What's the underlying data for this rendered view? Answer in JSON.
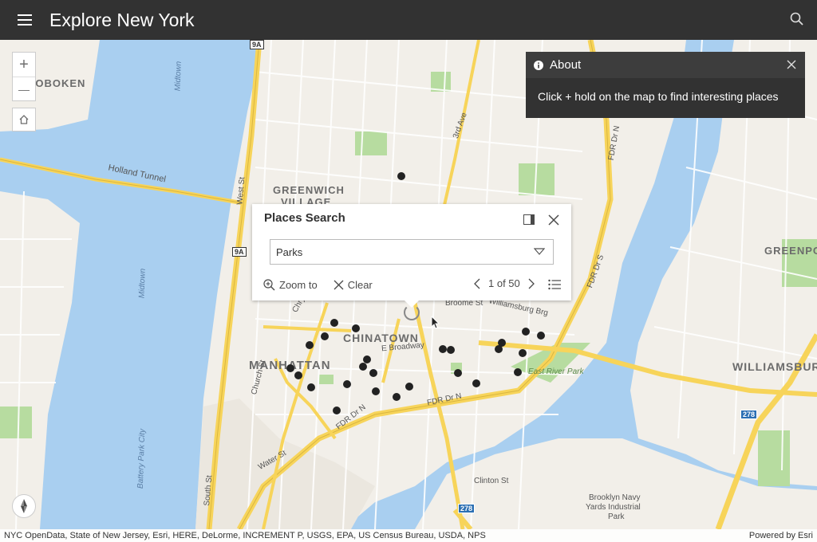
{
  "header": {
    "title": "Explore New York",
    "menu_icon": "hamburger-menu-icon",
    "search_icon": "search-icon"
  },
  "map_controls": {
    "zoom_in": "+",
    "zoom_out": "—",
    "home_icon": "home-icon",
    "compass_icon": "compass-icon"
  },
  "about": {
    "title": "About",
    "body": "Click + hold on the map to find interesting places",
    "info_icon": "info-icon",
    "close_icon": "close-icon"
  },
  "places_search": {
    "title": "Places Search",
    "category": "Parks",
    "zoom_to_label": "Zoom to",
    "clear_label": "Clear",
    "pager": "1 of 50"
  },
  "map_labels": {
    "hoboken": "HOBOKEN",
    "greenwich": "GREENWICH",
    "village": "VILLAGE",
    "chinatown": "CHINATOWN",
    "manhattan": "MANHATTAN",
    "williamsburg": "WILLIAMSBURG",
    "greenpoint": "GREENPO",
    "holland_tunnel": "Holland Tunnel",
    "fdr1": "FDR Dr N",
    "fdr2": "FDR Dr N",
    "fdr3": "FDR Dr S",
    "fdr4": "FDR Dr N",
    "west_st": "West St",
    "east_broadway": "E Broadway",
    "williamsburg_brg": "Williamsburg Brg",
    "east_river_park": "East River Park",
    "brooklyn_navy": "Brooklyn Navy",
    "yards_industrial": "Yards Industrial",
    "park": "Park",
    "church_st": "Church St",
    "south_st": "South St",
    "rt_9a_1": "9A",
    "rt_9a_2": "9A",
    "rt_278_1": "278",
    "rt_278_2": "278",
    "third_ave": "3rd Ave",
    "broome_st": "Broome St",
    "chrystie": "Chrystie",
    "water_st": "Water St",
    "midtown_w": "Midtown",
    "midtown_w2": "Midtown",
    "battery_park_city": "Battery Park City",
    "clinton_st": "Clinton St"
  },
  "attribution": {
    "text": "NYC OpenData, State of New Jersey, Esri, HERE, DeLorme, INCREMENT P, USGS, EPA, US Census Bureau, USDA, NPS",
    "powered_by": "Powered by Esri"
  },
  "colors": {
    "header_bg": "#323232",
    "water": "#a9cff0",
    "land": "#f2efe9",
    "highway": "#f7d45a",
    "park": "#b7dca0",
    "poi": "#222222"
  }
}
